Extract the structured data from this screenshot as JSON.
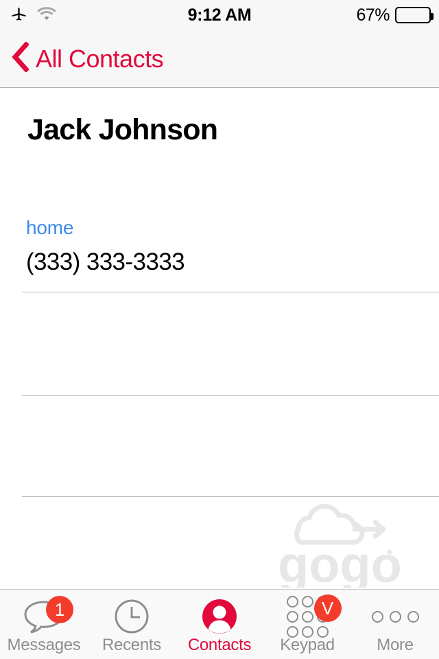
{
  "status_bar": {
    "airplane_icon": "airplane-icon",
    "wifi_icon": "wifi-icon",
    "time": "9:12 AM",
    "battery_percent": "67%",
    "battery_level": 67
  },
  "nav_bar": {
    "back_icon": "chevron-left-icon",
    "back_label": "All Contacts"
  },
  "contact": {
    "name": "Jack Johnson",
    "fields": [
      {
        "label": "home",
        "value": "(333) 333-3333"
      }
    ]
  },
  "watermark": {
    "text": "gogo",
    "logo_icon": "cloud-arrow-icon"
  },
  "tab_bar": {
    "tabs": [
      {
        "label": "Messages",
        "icon": "speech-bubble-icon",
        "badge": "1",
        "active": false
      },
      {
        "label": "Recents",
        "icon": "clock-icon",
        "badge": "",
        "active": false
      },
      {
        "label": "Contacts",
        "icon": "person-circle-icon",
        "badge": "",
        "active": true
      },
      {
        "label": "Keypad",
        "icon": "keypad-grid-icon",
        "badge": "V",
        "active": false
      },
      {
        "label": "More",
        "icon": "ellipsis-icon",
        "badge": "",
        "active": false
      }
    ]
  },
  "colors": {
    "accent_red": "#e2093b",
    "badge_red": "#f43c2c",
    "link_blue": "#3b8aea",
    "inactive_gray": "#8e8e8e"
  }
}
